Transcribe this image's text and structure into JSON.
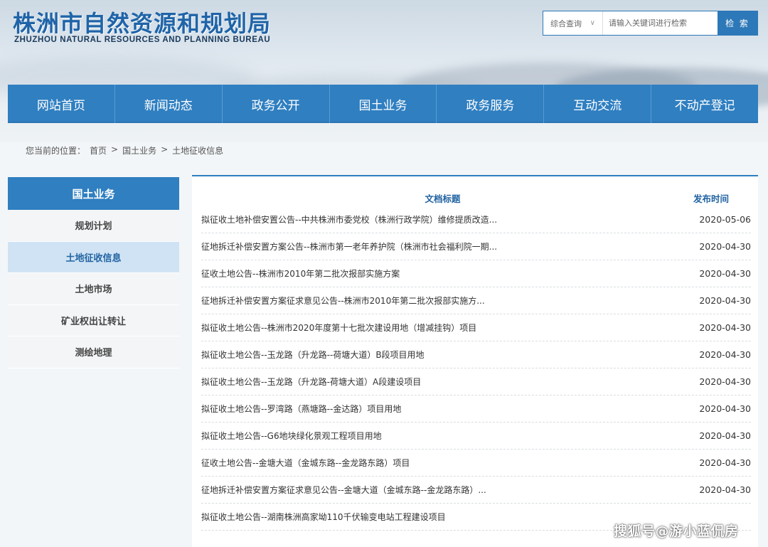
{
  "header": {
    "logo_cn": "株洲市自然资源和规划局",
    "logo_en": "ZHUZHOU NATURAL RESOURCES AND PLANNING BUREAU"
  },
  "search": {
    "select_value": "综合查询",
    "select_arrow": "∨",
    "placeholder": "请输入关键词进行检索",
    "button_label": "检 索"
  },
  "nav": {
    "items": [
      {
        "label": "网站首页"
      },
      {
        "label": "新闻动态"
      },
      {
        "label": "政务公开"
      },
      {
        "label": "国土业务"
      },
      {
        "label": "政务服务"
      },
      {
        "label": "互动交流"
      },
      {
        "label": "不动产登记"
      }
    ]
  },
  "breadcrumb": {
    "prefix": "您当前的位置：",
    "items": [
      "首页",
      "国土业务",
      "土地征收信息"
    ],
    "separator": ">"
  },
  "sidebar": {
    "title": "国土业务",
    "items": [
      {
        "label": "规划计划"
      },
      {
        "label": "土地征收信息"
      },
      {
        "label": "土地市场"
      },
      {
        "label": "矿业权出让转让"
      },
      {
        "label": "测绘地理"
      }
    ],
    "active_index": 1
  },
  "table": {
    "col_title": "文档标题",
    "col_date": "发布时间",
    "rows": [
      {
        "title": "拟征收土地补偿安置公告--中共株洲市委党校（株洲行政学院）维修提质改造...",
        "date": "2020-05-06"
      },
      {
        "title": "征地拆迁补偿安置方案公告--株洲市第一老年养护院（株洲市社会福利院一期...",
        "date": "2020-04-30"
      },
      {
        "title": "征收土地公告--株洲市2010年第二批次报部实施方案",
        "date": "2020-04-30"
      },
      {
        "title": "征地拆迁补偿安置方案征求意见公告--株洲市2010年第二批次报部实施方...",
        "date": "2020-04-30"
      },
      {
        "title": "拟征收土地公告--株洲市2020年度第十七批次建设用地（增减挂钩）项目",
        "date": "2020-04-30"
      },
      {
        "title": "拟征收土地公告--玉龙路（升龙路--荷塘大道）B段项目用地",
        "date": "2020-04-30"
      },
      {
        "title": "拟征收土地公告--玉龙路（升龙路-荷塘大道）A段建设项目",
        "date": "2020-04-30"
      },
      {
        "title": "拟征收土地公告--罗湾路（燕塘路--金达路）项目用地",
        "date": "2020-04-30"
      },
      {
        "title": "拟征收土地公告--G6地块绿化景观工程项目用地",
        "date": "2020-04-30"
      },
      {
        "title": "征收土地公告--金塘大道（金城东路--金龙路东路）项目",
        "date": "2020-04-30"
      },
      {
        "title": "征地拆迁补偿安置方案征求意见公告--金塘大道（金城东路--金龙路东路）...",
        "date": "2020-04-30"
      },
      {
        "title": "拟征收土地公告--湖南株洲高家坳110千伏输变电站工程建设项目",
        "date": ""
      }
    ]
  },
  "watermark": "搜狐号@游小蓝侃房"
}
